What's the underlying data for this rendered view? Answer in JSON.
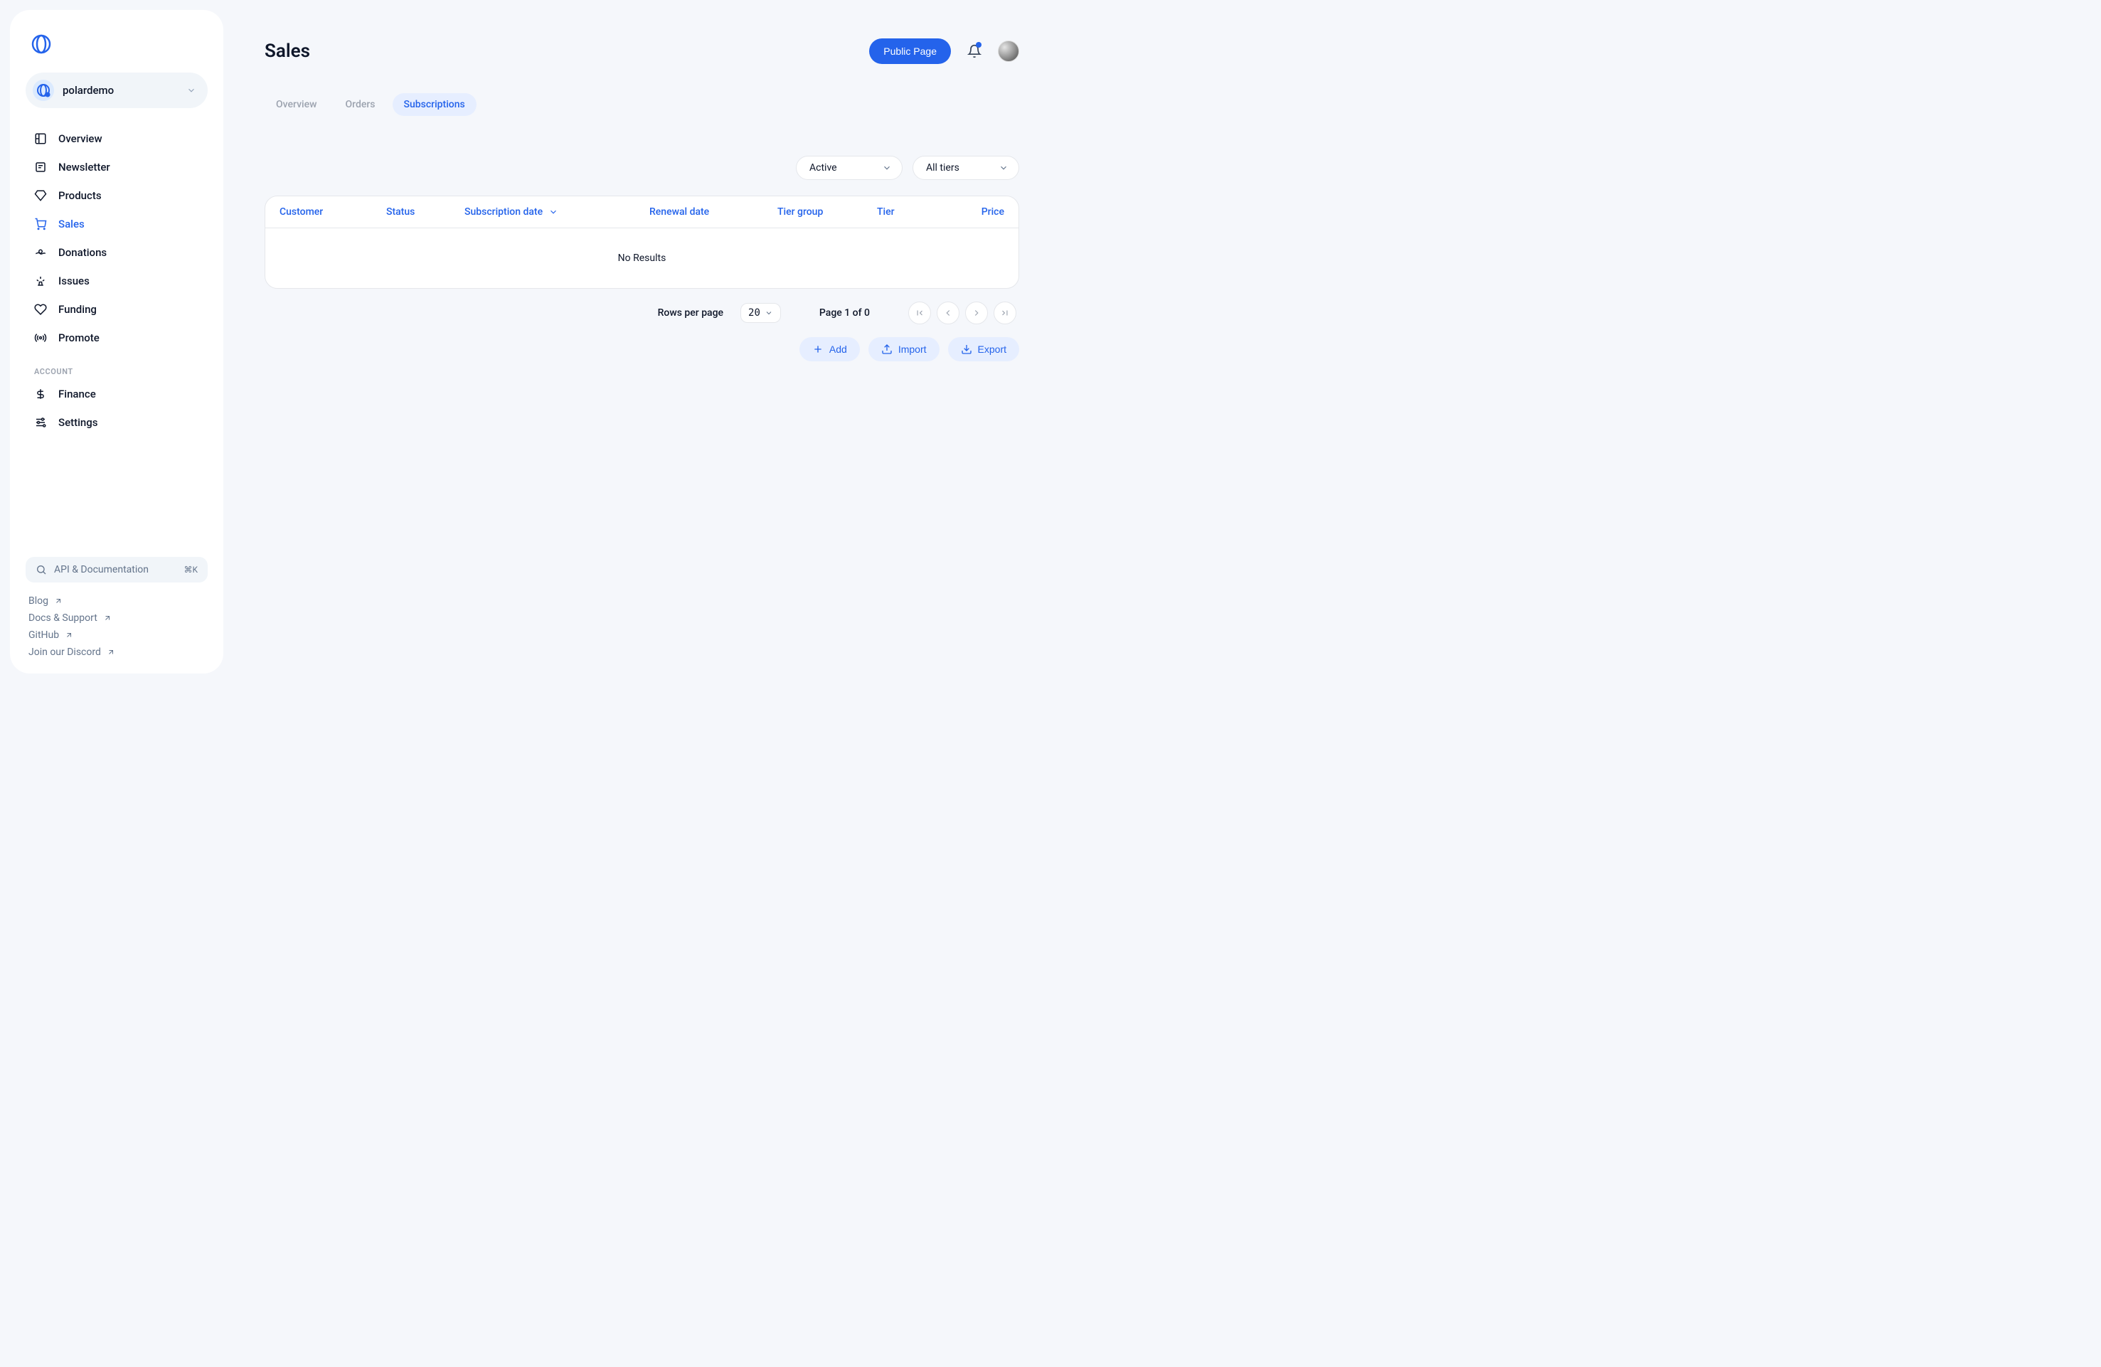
{
  "org": {
    "name": "polardemo"
  },
  "nav": {
    "items": [
      {
        "label": "Overview"
      },
      {
        "label": "Newsletter"
      },
      {
        "label": "Products"
      },
      {
        "label": "Sales"
      },
      {
        "label": "Donations"
      },
      {
        "label": "Issues"
      },
      {
        "label": "Funding"
      },
      {
        "label": "Promote"
      }
    ],
    "account_label": "ACCOUNT",
    "account_items": [
      {
        "label": "Finance"
      },
      {
        "label": "Settings"
      }
    ],
    "api_label": "API & Documentation",
    "api_key": "⌘K",
    "ext_links": [
      {
        "label": "Blog"
      },
      {
        "label": "Docs & Support"
      },
      {
        "label": "GitHub"
      },
      {
        "label": "Join our Discord"
      }
    ]
  },
  "header": {
    "title": "Sales",
    "public_page": "Public Page"
  },
  "tabs": [
    {
      "label": "Overview"
    },
    {
      "label": "Orders"
    },
    {
      "label": "Subscriptions"
    }
  ],
  "filters": {
    "status": "Active",
    "tier": "All tiers"
  },
  "table": {
    "columns": [
      "Customer",
      "Status",
      "Subscription date",
      "Renewal date",
      "Tier group",
      "Tier",
      "Price"
    ],
    "empty": "No Results"
  },
  "pager": {
    "rows_label": "Rows per page",
    "rows_value": "20",
    "page_text": "Page 1 of 0"
  },
  "actions": {
    "add": "Add",
    "import": "Import",
    "export": "Export"
  }
}
